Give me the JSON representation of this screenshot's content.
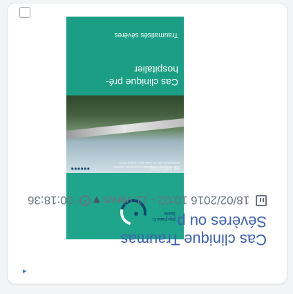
{
  "card": {
    "title": "Cas clinique Traumas",
    "title_line2": "Sévères ou p...",
    "date": "18/02/2016 10:02 - 11 views",
    "time": "00:18:36"
  },
  "thumbnail": {
    "brand": "Oru Paca C-Sante",
    "title": "Cas clinique pré-hospitalier",
    "subtitle": "Traumatisés sévères",
    "date": "Avr. 19/02/2016",
    "caption": "Cas clinique pre hospitalier traumatisés sévères, présentation de cas issus de la région PACA"
  }
}
